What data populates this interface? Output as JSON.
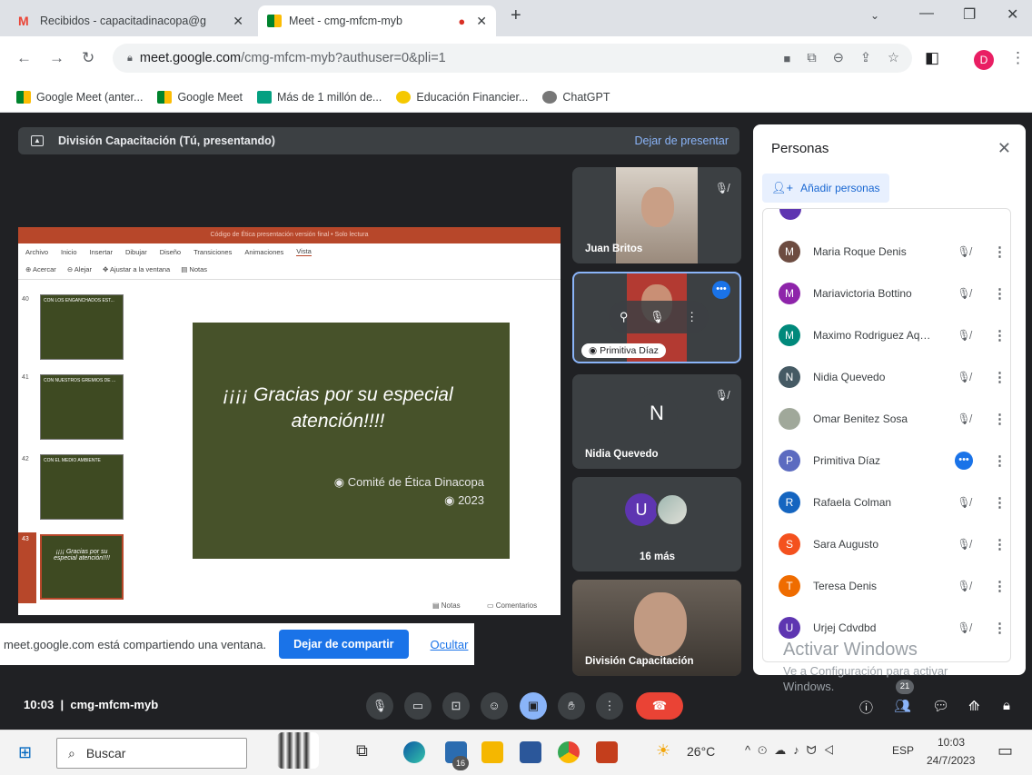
{
  "browser": {
    "tabs": [
      {
        "label": "Recibidos - capacitadinacopa@g",
        "active": false
      },
      {
        "label": "Meet - cmg-mfcm-myb",
        "active": true
      }
    ],
    "url_host": "meet.google.com",
    "url_path": "/cmg-mfcm-myb?authuser=0&pli=1",
    "profile_initial": "D",
    "bookmarks": [
      "Google Meet (anter...",
      "Google Meet",
      "Más de 1 millón de...",
      "Educación Financier...",
      "ChatGPT"
    ]
  },
  "meet": {
    "presenting_label": "División Capacitación (Tú, presentando)",
    "stop_presenting": "Dejar de presentar",
    "share_notice": "meet.google.com está compartiendo una ventana.",
    "stop_sharing": "Dejar de compartir",
    "hide": "Ocultar",
    "time": "10:03",
    "meeting_code": "cmg-mfcm-myb",
    "tiles": [
      {
        "name": "Juan Britos"
      },
      {
        "name": "Primitiva Díaz"
      },
      {
        "name": "Nidia Quevedo",
        "initial": "N"
      },
      {
        "name": "16 más",
        "initial": "U"
      },
      {
        "name": "División Capacitación"
      }
    ],
    "participants_badge": "21"
  },
  "ppt": {
    "title": "Código de Ética presentación versión final • Solo lectura",
    "menu": [
      "Archivo",
      "Inicio",
      "Insertar",
      "Dibujar",
      "Diseño",
      "Transiciones",
      "Animaciones",
      "Vista"
    ],
    "view_tools": [
      "Acercar",
      "Alejar",
      "Ajustar a la ventana",
      "Notas"
    ],
    "thumbs": [
      {
        "num": "40",
        "text": "CON LOS ENGANCHADOS EST..."
      },
      {
        "num": "41",
        "text": "CON NUESTROS GREMIOS DE ..."
      },
      {
        "num": "42",
        "text": "CON EL MEDIO AMBIENTE"
      },
      {
        "num": "43",
        "text": "¡¡¡¡ Gracias por su especial atención!!!!"
      }
    ],
    "slide_text": "¡¡¡¡ Gracias por su especial atención!!!!",
    "slide_sub1": "◉ Comité de Ética Dinacopa",
    "slide_sub2": "◉ 2023",
    "status_notes": "Notas",
    "status_comments": "Comentarios"
  },
  "people": {
    "title": "Personas",
    "add": "Añadir personas",
    "list": [
      {
        "name": "Maria Roque Denis",
        "initial": "M",
        "color": "#6d4c41"
      },
      {
        "name": "Mariavictoria Bottino",
        "initial": "M",
        "color": "#8e24aa"
      },
      {
        "name": "Maximo Rodriguez Aqui...",
        "initial": "M",
        "color": "#00897b"
      },
      {
        "name": "Nidia Quevedo",
        "initial": "N",
        "color": "#455a64"
      },
      {
        "name": "Omar Benitez Sosa",
        "initial": "",
        "color": "#a0a89a"
      },
      {
        "name": "Primitiva Díaz",
        "initial": "P",
        "color": "#5c6bc0"
      },
      {
        "name": "Rafaela Colman",
        "initial": "R",
        "color": "#1565c0"
      },
      {
        "name": "Sara Augusto",
        "initial": "S",
        "color": "#f4511e"
      },
      {
        "name": "Teresa Denis",
        "initial": "T",
        "color": "#ef6c00"
      },
      {
        "name": "Urjej Cdvdbd",
        "initial": "U",
        "color": "#5e35b1"
      }
    ]
  },
  "watermark": {
    "line1": "Activar Windows",
    "line2": "Ve a Configuración para activar Windows."
  },
  "taskbar": {
    "search": "Buscar",
    "temp": "26°C",
    "lang": "ESP",
    "time": "10:03",
    "date": "24/7/2023",
    "badge": "16"
  }
}
